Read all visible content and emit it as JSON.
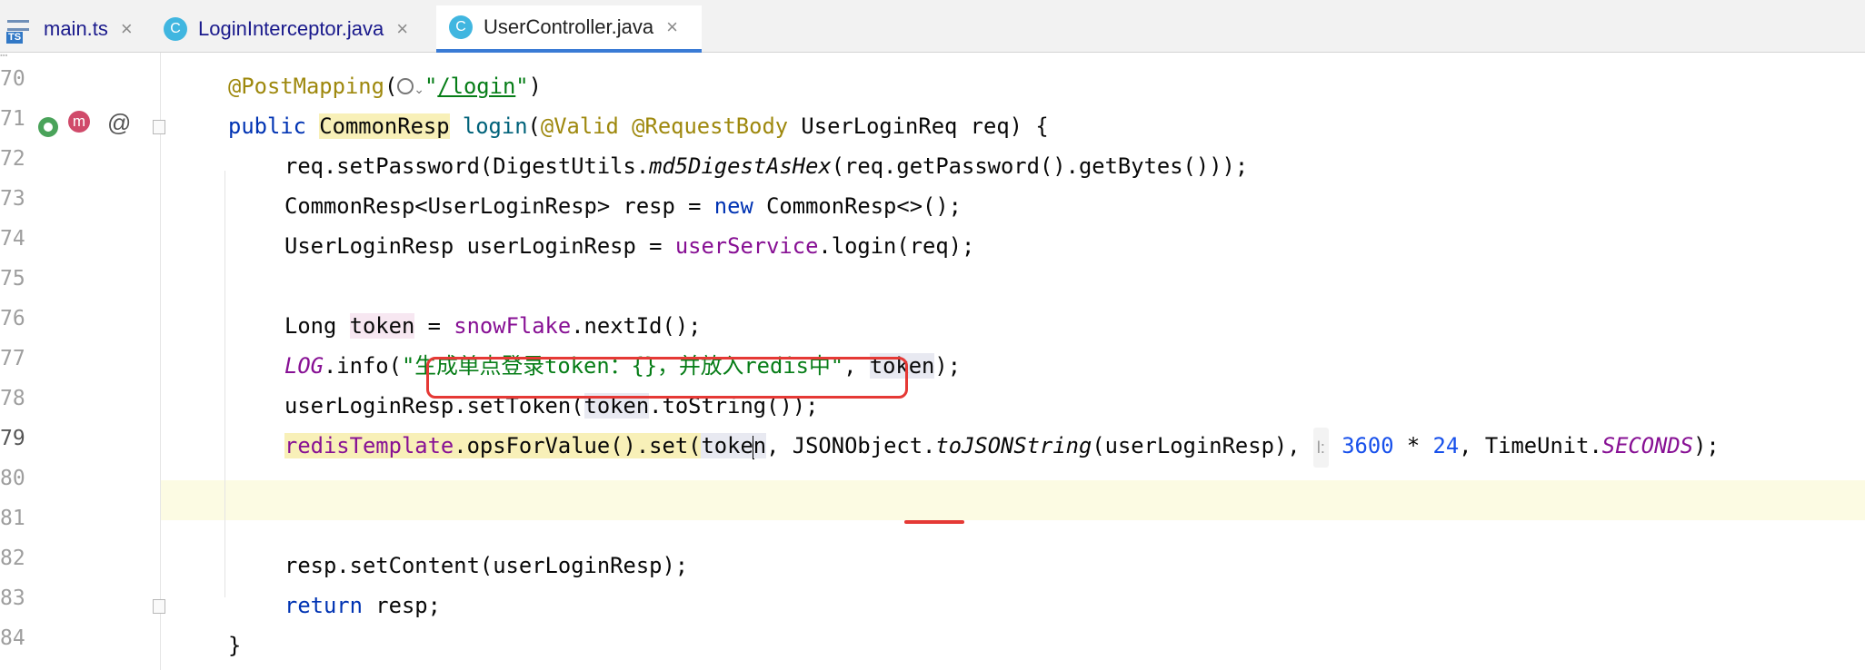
{
  "tabs": [
    {
      "label": "main.ts",
      "icon": "ts-file-icon",
      "active": false
    },
    {
      "label": "LoginInterceptor.java",
      "icon": "java-class-icon",
      "active": false
    },
    {
      "label": "UserController.java",
      "icon": "java-class-icon",
      "active": true
    }
  ],
  "tab_icon_text": {
    "ts": "TS",
    "c": "C"
  },
  "close_glyph": "×",
  "line_numbers": [
    "70",
    "71",
    "72",
    "73",
    "74",
    "75",
    "76",
    "77",
    "78",
    "79",
    "80",
    "81",
    "82",
    "83",
    "84"
  ],
  "current_line": "79",
  "gutter_icons": {
    "method_marker": "m",
    "annotation": "@"
  },
  "code": {
    "l70": {
      "ann": "@PostMapping",
      "open": "(",
      "globe_chev": "⌄",
      "q1": "\"",
      "path": "/login",
      "q2": "\"",
      "close": ")"
    },
    "l71": {
      "kw": "public",
      "sp1": " ",
      "type": "CommonResp",
      "sp2": " ",
      "method": "login",
      "open": "(",
      "ann1": "@Valid",
      "sp3": " ",
      "ann2": "@RequestBody",
      "rest": " UserLoginReq req) {"
    },
    "l72": {
      "a": "req.setPassword(DigestUtils.",
      "b": "md5DigestAsHex",
      "c": "(req.getPassword().getBytes()));"
    },
    "l73": {
      "a": "CommonResp<UserLoginResp> resp = ",
      "kw": "new",
      "b": " CommonResp<>();"
    },
    "l74": {
      "a": "UserLoginResp userLoginResp = ",
      "fld": "userService",
      "b": ".login(req);"
    },
    "l76": {
      "a": "Long ",
      "var": "token",
      "b": " = ",
      "fld": "snowFlake",
      "c": ".nextId();"
    },
    "l77": {
      "log": "LOG",
      "a": ".info(",
      "str": "\"生成单点登录token：{}，并放入redis中\"",
      "b": ", ",
      "var": "token",
      "c": ");"
    },
    "l78": {
      "a": "userLoginResp.setToken(",
      "var": "token",
      "b": ".toString());"
    },
    "l79": {
      "fld": "redisTemplate",
      "a": ".opsForValue().set(",
      "var1": "toke",
      "var2": "n",
      "b": ", JSONObject.",
      "m": "toJSONString",
      "c": "(userLoginResp), ",
      "hint": "l:",
      "n1": "3600",
      "op": " * ",
      "n2": "24",
      "d": ", TimeUnit.",
      "e": "SECONDS",
      "f": ");"
    },
    "l81": {
      "a": "resp.setContent(userLoginResp);"
    },
    "l82": {
      "kw": "return",
      "a": " resp;"
    },
    "l83": {
      "a": "}"
    }
  },
  "colors": {
    "keyword": "#0033b3",
    "annotation": "#9e880d",
    "string": "#067d17",
    "field": "#871094",
    "number": "#1750eb",
    "annotation_box": "#e53935",
    "active_tab_underline": "#3a7bd5"
  }
}
